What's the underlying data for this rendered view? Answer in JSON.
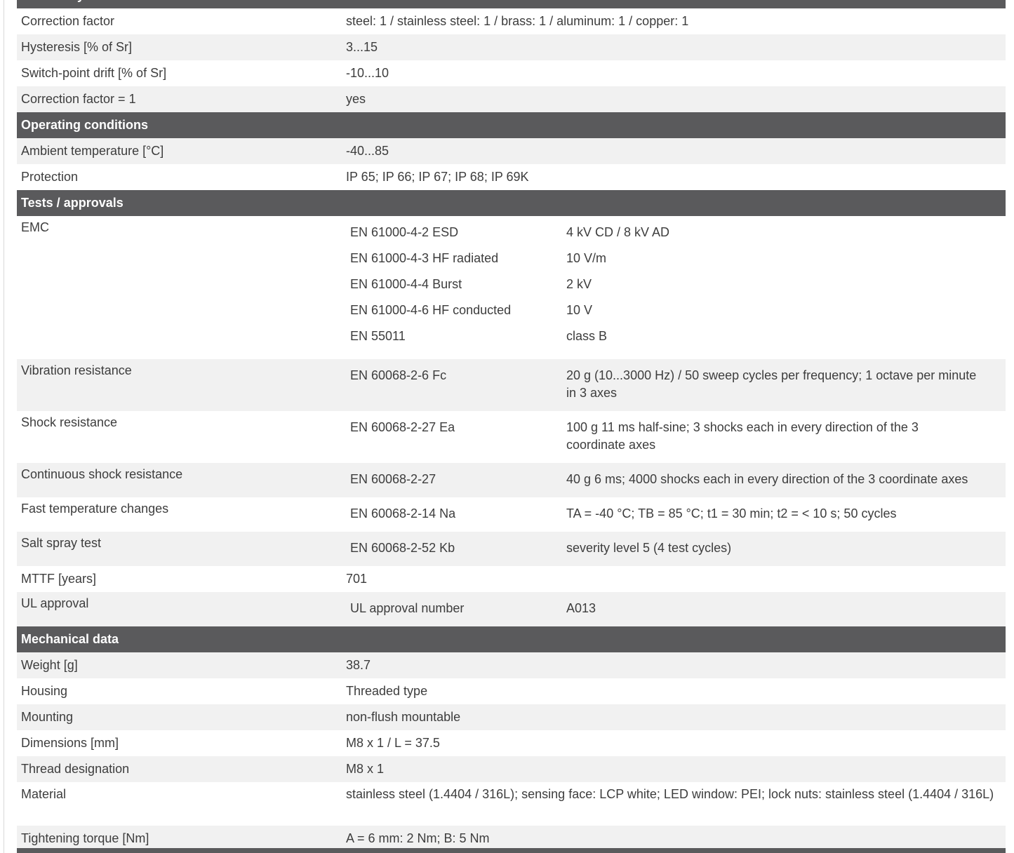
{
  "page": {
    "cut_section_title": "Sensitivity",
    "rows_a": [
      {
        "label": "Correction factor",
        "value": "steel: 1 / stainless steel: 1 / brass: 1 / aluminum: 1 / copper: 1"
      },
      {
        "label": "Hysteresis [% of Sr]",
        "value": "3...15"
      },
      {
        "label": "Switch-point drift [% of Sr]",
        "value": "-10...10"
      },
      {
        "label": "Correction factor = 1",
        "value": "yes"
      }
    ],
    "operating": {
      "title": "Operating conditions",
      "rows": [
        {
          "label": "Ambient temperature [°C]",
          "value": "-40...85"
        },
        {
          "label": "Protection",
          "value": "IP 65; IP 66; IP 67; IP 68; IP 69K"
        }
      ]
    },
    "tests": {
      "title": "Tests / approvals",
      "emc": {
        "label": "EMC",
        "items": [
          {
            "name": "EN 61000-4-2 ESD",
            "value": "4 kV CD / 8 kV AD"
          },
          {
            "name": "EN 61000-4-3 HF radiated",
            "value": "10 V/m"
          },
          {
            "name": "EN 61000-4-4 Burst",
            "value": "2 kV"
          },
          {
            "name": "EN 61000-4-6 HF conducted",
            "value": "10 V"
          },
          {
            "name": "EN 55011",
            "value": "class B"
          }
        ]
      },
      "vibration": {
        "label": "Vibration resistance",
        "name": "EN 60068-2-6 Fc",
        "value": "20 g (10...3000 Hz) / 50 sweep cycles per frequency; 1 octave per minute in 3 axes"
      },
      "shock": {
        "label": "Shock resistance",
        "name": "EN 60068-2-27 Ea",
        "value": "100 g 11 ms half-sine; 3 shocks each in every direction of the 3 coordinate axes"
      },
      "continuous_shock": {
        "label": "Continuous shock resistance",
        "name": "EN 60068-2-27",
        "value": "40 g 6 ms; 4000 shocks each in every direction of the 3 coordinate axes"
      },
      "fast_temp": {
        "label": "Fast temperature changes",
        "name": "EN 60068-2-14 Na",
        "value": "TA = -40 °C; TB = 85 °C; t1 = 30 min; t2 = < 10 s; 50 cycles"
      },
      "salt_spray": {
        "label": "Salt spray test",
        "name": "EN 60068-2-52 Kb",
        "value": "severity level 5 (4 test cycles)"
      },
      "mttf": {
        "label": "MTTF [years]",
        "value": "701"
      },
      "ul": {
        "label": "UL approval",
        "name": "UL approval number",
        "value": "A013"
      }
    },
    "mechanical": {
      "title": "Mechanical data",
      "rows": [
        {
          "label": "Weight [g]",
          "value": "38.7"
        },
        {
          "label": "Housing",
          "value": "Threaded type"
        },
        {
          "label": "Mounting",
          "value": "non-flush mountable"
        },
        {
          "label": "Dimensions [mm]",
          "value": "M8 x 1 / L = 37.5"
        },
        {
          "label": "Thread designation",
          "value": "M8 x 1"
        },
        {
          "label": "Material",
          "value": "stainless steel (1.4404 / 316L); sensing face: LCP white; LED window: PEI; lock nuts: stainless steel (1.4404 / 316L)"
        },
        {
          "label": "Tightening torque [Nm]",
          "value": "A = 6 mm: 2 Nm; B: 5 Nm"
        }
      ]
    }
  }
}
